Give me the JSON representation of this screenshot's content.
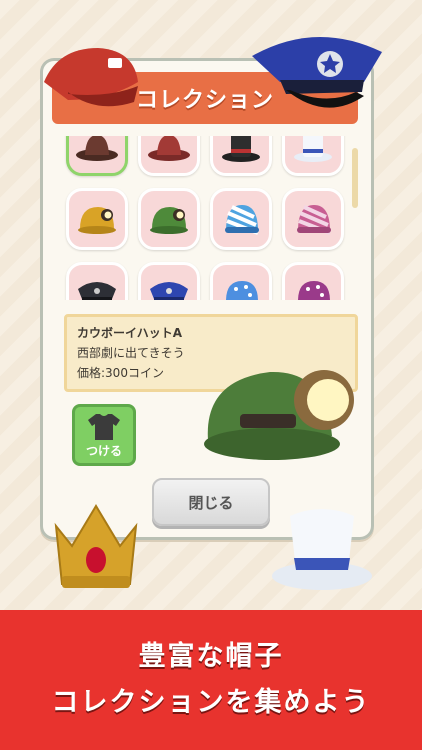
{
  "panel": {
    "title": "コレクション"
  },
  "info": {
    "name": "カウボーイハットA",
    "description": "西部劇に出てきそう",
    "price": "価格:300コイン"
  },
  "buttons": {
    "wear_label": "つける",
    "close_label": "閉じる"
  },
  "banner": {
    "line1": "豊富な帽子",
    "line2": "コレクションを集めよう"
  },
  "grid_items": [
    {
      "icon": "cowboy-hat-brown-icon"
    },
    {
      "icon": "cowboy-hat-red-icon"
    },
    {
      "icon": "top-hat-black-icon"
    },
    {
      "icon": "top-hat-white-icon"
    },
    {
      "icon": "mining-helmet-yellow-icon"
    },
    {
      "icon": "mining-helmet-green-icon"
    },
    {
      "icon": "beanie-blue-icon"
    },
    {
      "icon": "beanie-pink-icon"
    },
    {
      "icon": "police-cap-black-icon"
    },
    {
      "icon": "police-cap-blue-icon"
    },
    {
      "icon": "cap-blue-dots-icon"
    },
    {
      "icon": "cap-purple-dots-icon"
    }
  ],
  "colors": {
    "header": "#e86f45",
    "banner": "#e8332e",
    "cell_bg": "#f8d8d8",
    "selected_border": "#8fd46a",
    "wear_button": "#7fcf63"
  }
}
